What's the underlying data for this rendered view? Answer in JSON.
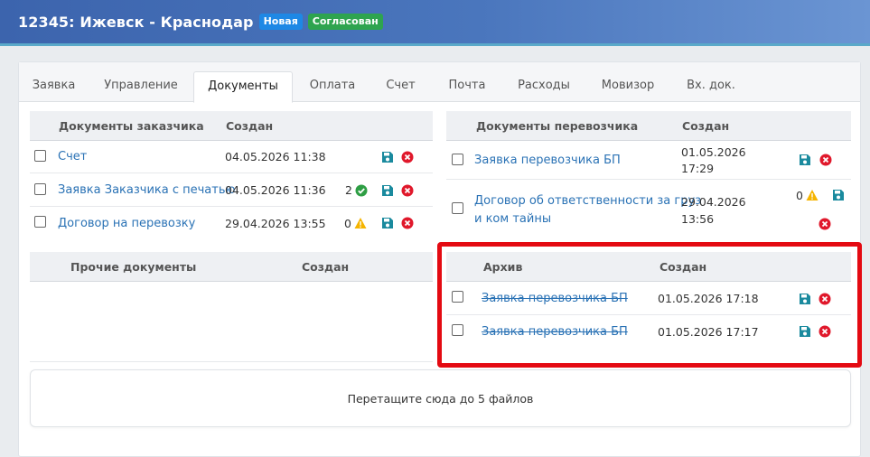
{
  "header": {
    "title": "12345: Ижевск - Краснодар",
    "badge_new": "Новая",
    "badge_status": "Согласован"
  },
  "tabs": [
    {
      "label": "Заявка"
    },
    {
      "label": "Управление"
    },
    {
      "label": "Документы",
      "active": true
    },
    {
      "label": "Оплата"
    },
    {
      "label": "Счет"
    },
    {
      "label": "Почта"
    },
    {
      "label": "Расходы"
    },
    {
      "label": "Мовизор"
    },
    {
      "label": "Вх. док."
    }
  ],
  "customer_docs": {
    "header_name": "Документы заказчика",
    "header_created": "Создан",
    "rows": [
      {
        "name": "Счет",
        "created": "04.05.2026 11:38",
        "count": "",
        "status_icon": ""
      },
      {
        "name": "Заявка Заказчика с печатью",
        "created": "04.05.2026 11:36",
        "count": "2",
        "status_icon": "check-circle-icon"
      },
      {
        "name": "Договор на перевозку",
        "created": "29.04.2026 13:55",
        "count": "0",
        "status_icon": "warning-icon"
      }
    ]
  },
  "carrier_docs": {
    "header_name": "Документы перевозчика",
    "header_created": "Создан",
    "rows": [
      {
        "name": "Заявка перевозчика БП",
        "created_line1": "01.05.2026",
        "created_line2": "17:29",
        "count": "",
        "status_icon": ""
      },
      {
        "name_line1": "Договор об ответственности за груз",
        "name_line2": "и ком тайны",
        "created_line1": "29.04.2026",
        "created_line2": "13:56",
        "count": "0",
        "status_icon": "warning-icon"
      }
    ]
  },
  "other_docs": {
    "header_name": "Прочие документы",
    "header_created": "Создан"
  },
  "archive": {
    "header_name": "Архив",
    "header_created": "Создан",
    "rows": [
      {
        "name": "Заявка перевозчика БП",
        "created": "01.05.2026 17:18"
      },
      {
        "name": "Заявка перевозчика БП",
        "created": "01.05.2026 17:17"
      }
    ]
  },
  "dropzone": {
    "text": "Перетащите сюда до 5 файлов"
  },
  "colors": {
    "header_bg": "#4a76bd",
    "badge_new": "#1e88e5",
    "badge_status": "#2ea44f",
    "link": "#2a72b5",
    "save_icon": "#1a8a9e",
    "delete_icon": "#e0182b",
    "warning_icon": "#f5b400",
    "check_icon": "#2e9e44",
    "highlight_border": "#e40a12"
  }
}
